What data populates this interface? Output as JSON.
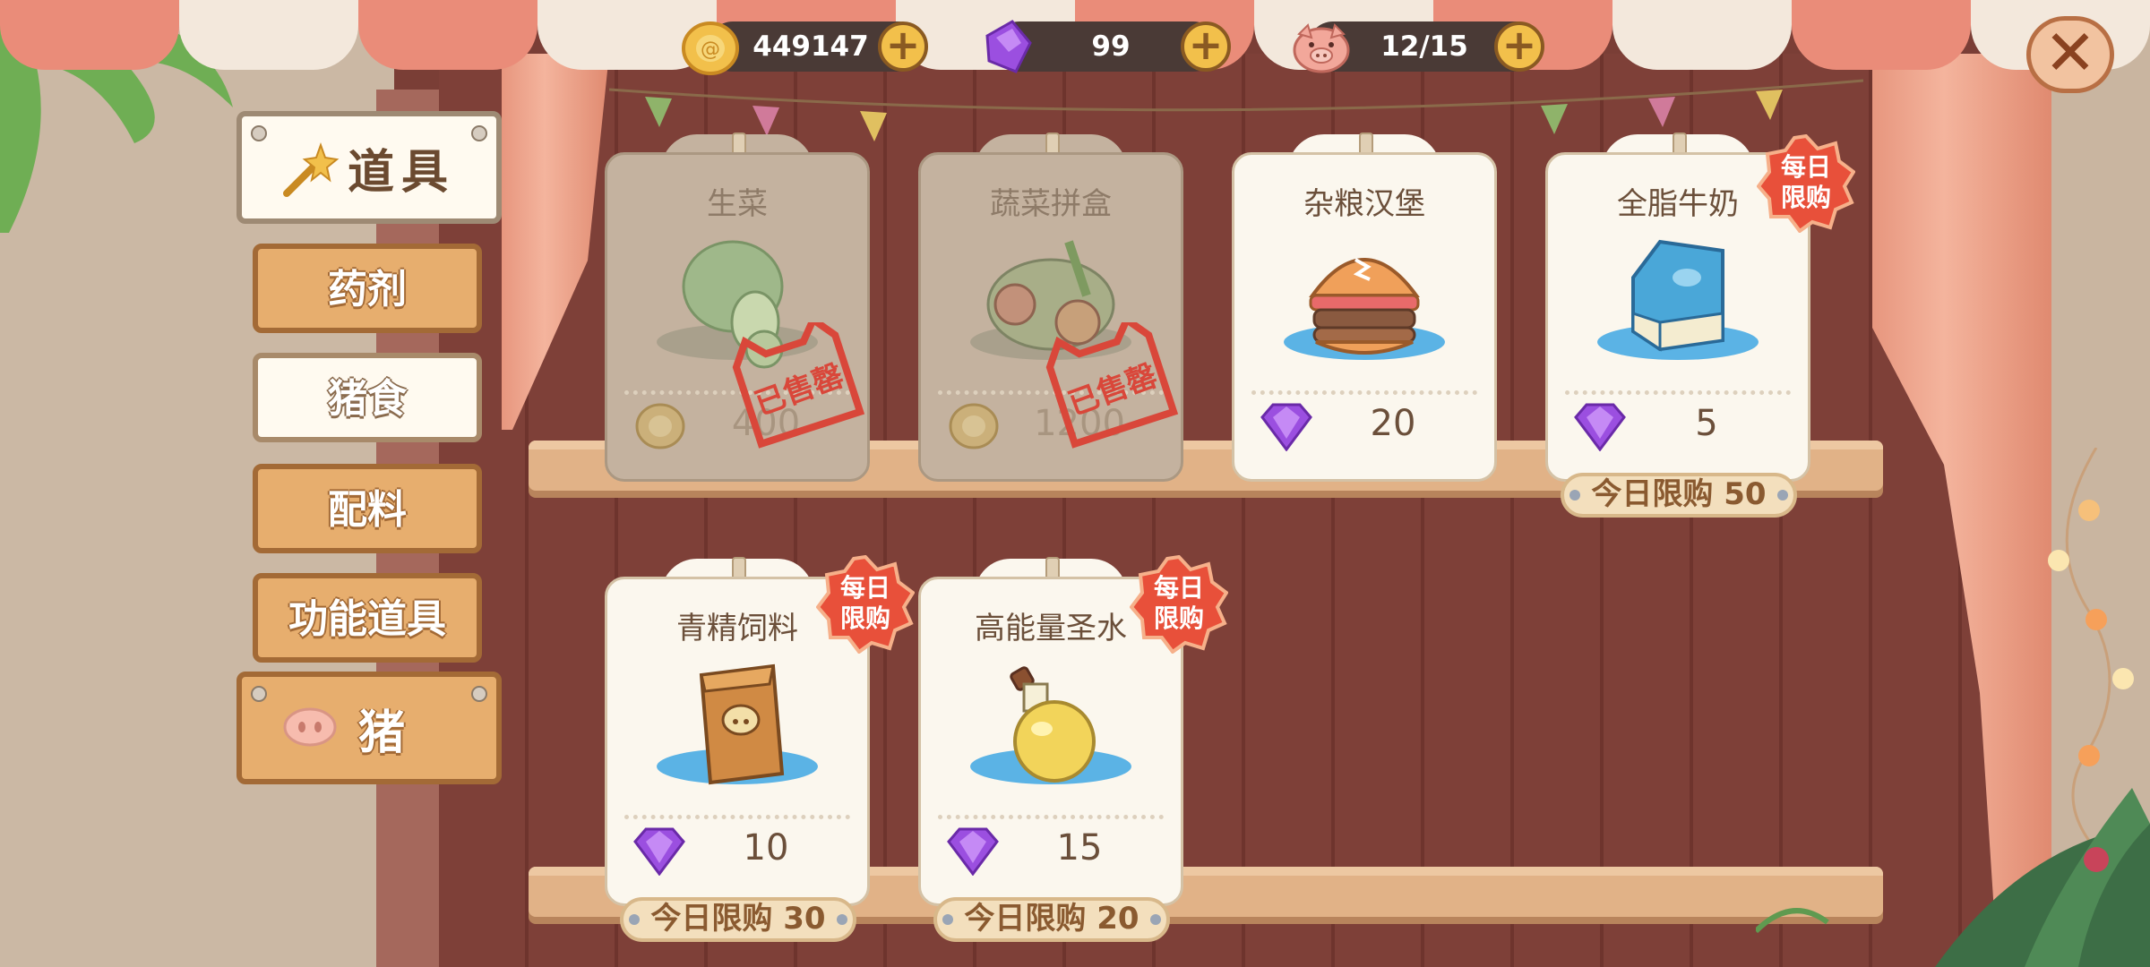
{
  "resources": {
    "coins": {
      "value": "449147",
      "icon": "gold-coin-icon"
    },
    "gems": {
      "value": "99",
      "icon": "purple-gem-icon"
    },
    "pigs": {
      "value": "12/15",
      "icon": "pig-face-icon"
    },
    "plus_symbol": "+",
    "close_symbol": "✕"
  },
  "menu": {
    "header": {
      "label": "道具",
      "icon": "magic-wand-icon"
    },
    "categories": [
      {
        "label": "药剂",
        "selected": false
      },
      {
        "label": "猪食",
        "selected": true
      },
      {
        "label": "配料",
        "selected": false
      },
      {
        "label": "功能道具",
        "selected": false
      }
    ],
    "footer": {
      "label": "猪",
      "icon": "pig-nose-icon"
    }
  },
  "shop_items": [
    {
      "name": "生菜",
      "price": "400",
      "currency": "coin",
      "sold_out": true,
      "stamp": "已售罄"
    },
    {
      "name": "蔬菜拼盒",
      "price": "1200",
      "currency": "coin",
      "sold_out": true,
      "stamp": "已售罄"
    },
    {
      "name": "杂粮汉堡",
      "price": "20",
      "currency": "gem",
      "sold_out": false
    },
    {
      "name": "全脂牛奶",
      "price": "5",
      "currency": "gem",
      "sold_out": false,
      "badge": "每日限购",
      "limit": "今日限购 50"
    },
    {
      "name": "青精饲料",
      "price": "10",
      "currency": "gem",
      "sold_out": false,
      "badge": "每日限购",
      "limit": "今日限购 30"
    },
    {
      "name": "高能量圣水",
      "price": "15",
      "currency": "gem",
      "sold_out": false,
      "badge": "每日限购",
      "limit": "今日限购 20"
    }
  ],
  "badge_lines": [
    "每日",
    "限购"
  ],
  "colors": {
    "gem": "#9b4fe0",
    "coin": "#f2c04b",
    "badge": "#e8503a",
    "stamp": "#d9473a",
    "accent_wood": "#e7ae6e"
  }
}
